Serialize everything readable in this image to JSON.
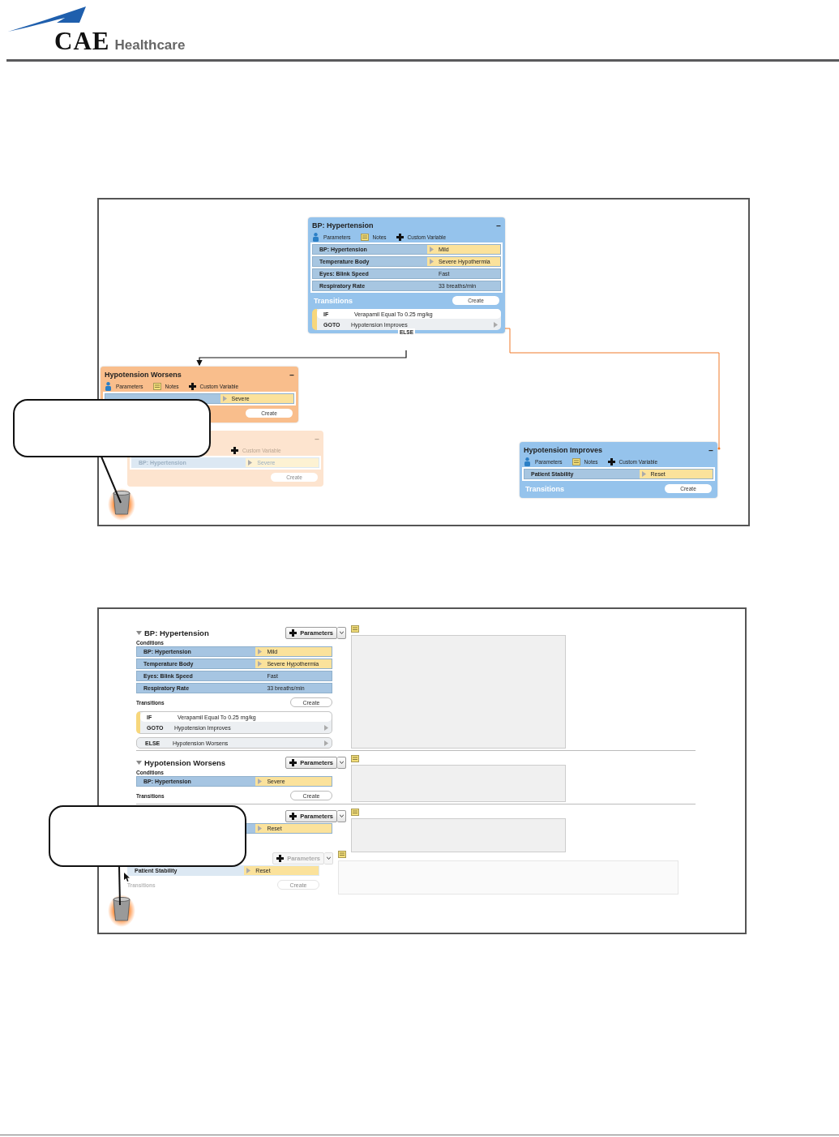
{
  "header": {
    "brand": "CAE",
    "brand_sub": "Healthcare"
  },
  "flowchart": {
    "cards": [
      {
        "kind": "state",
        "color": "#95c3ec",
        "title": "BP: Hypertension",
        "collapse": "−",
        "toolbar": [
          {
            "kind": "parameters",
            "label": "Parameters"
          },
          {
            "kind": "notes",
            "label": "Notes"
          },
          {
            "kind": "custom",
            "label": "Custom Variable"
          }
        ],
        "rows": [
          {
            "label": "BP: Hypertension",
            "value": "Mild",
            "kind": "set"
          },
          {
            "label": "Temperature Body",
            "value": "Severe Hypothermia",
            "kind": "set"
          },
          {
            "label": "Eyes: Blink Speed",
            "value": "Fast",
            "kind": "info"
          },
          {
            "label": "Respiratory Rate",
            "value": "33 breaths/min",
            "kind": "info"
          }
        ],
        "transitions_label": "Transitions",
        "create": "Create",
        "transitions": [
          {
            "if_label": "IF",
            "if_text": "Verapamil Equal To 0.25 mg/kg",
            "goto_label": "GOTO",
            "goto_text": "Hypotension Improves"
          }
        ],
        "else": "ELSE"
      },
      {
        "kind": "state",
        "color": "#f9be8c",
        "title": "Hypotension Worsens",
        "collapse": "−",
        "toolbar": [
          {
            "kind": "parameters",
            "label": "Parameters"
          },
          {
            "kind": "notes",
            "label": "Notes"
          },
          {
            "kind": "custom",
            "label": "Custom Variable"
          }
        ],
        "rows": [
          {
            "value": "Severe",
            "kind": "set"
          }
        ],
        "create": "Create"
      },
      {
        "kind": "ghost",
        "color": "#fde4cf",
        "collapse": "−",
        "toolbar": [
          {
            "kind": "custom",
            "label": "Custom Variable"
          }
        ],
        "rows": [
          {
            "label": "BP: Hypertension",
            "value": "Severe",
            "kind": "set"
          }
        ],
        "create": "Create"
      },
      {
        "kind": "state",
        "color": "#95c3ec",
        "title": "Hypotension Improves",
        "collapse": "−",
        "toolbar": [
          {
            "kind": "parameters",
            "label": "Parameters"
          },
          {
            "kind": "notes",
            "label": "Notes"
          },
          {
            "kind": "custom",
            "label": "Custom Variable"
          }
        ],
        "rows": [
          {
            "label": "Patient Stability",
            "value": "Reset",
            "kind": "set"
          }
        ],
        "transitions_label": "Transitions",
        "create": "Create"
      }
    ]
  },
  "list": {
    "sections": [
      {
        "kind": "section",
        "expanded": true,
        "title": "BP: Hypertension",
        "parameters": "Parameters",
        "conditions_label": "Conditions",
        "rows": [
          {
            "label": "BP: Hypertension",
            "value": "Mild",
            "kind": "set"
          },
          {
            "label": "Temperature Body",
            "value": "Severe Hypothermia",
            "kind": "set"
          },
          {
            "label": "Eyes: Blink Speed",
            "value": "Fast",
            "kind": "info"
          },
          {
            "label": "Respiratory Rate",
            "value": "33 breaths/min",
            "kind": "info"
          }
        ],
        "transitions_label": "Transitions",
        "create": "Create",
        "transitions": [
          {
            "if_label": "IF",
            "if_text": "Verapamil Equal To 0.25 mg/kg",
            "goto_label": "GOTO",
            "goto_text": "Hypotension Improves"
          }
        ],
        "else": {
          "label": "ELSE",
          "text": "Hypotension Worsens"
        }
      },
      {
        "kind": "section",
        "expanded": true,
        "title": "Hypotension Worsens",
        "parameters": "Parameters",
        "conditions_label": "Conditions",
        "rows": [
          {
            "label": "BP: Hypertension",
            "value": "Severe",
            "kind": "set"
          }
        ],
        "transitions_label": "Transitions",
        "create": "Create"
      },
      {
        "kind": "section",
        "parameters": "Parameters",
        "rows": [
          {
            "value": "Reset",
            "kind": "set"
          }
        ]
      },
      {
        "kind": "ghost",
        "parameters": "Parameters",
        "rows": [
          {
            "label": "Patient Stability",
            "value": "Reset",
            "kind": "set"
          }
        ],
        "transitions_label": "Transitions",
        "create": "Create"
      }
    ]
  }
}
